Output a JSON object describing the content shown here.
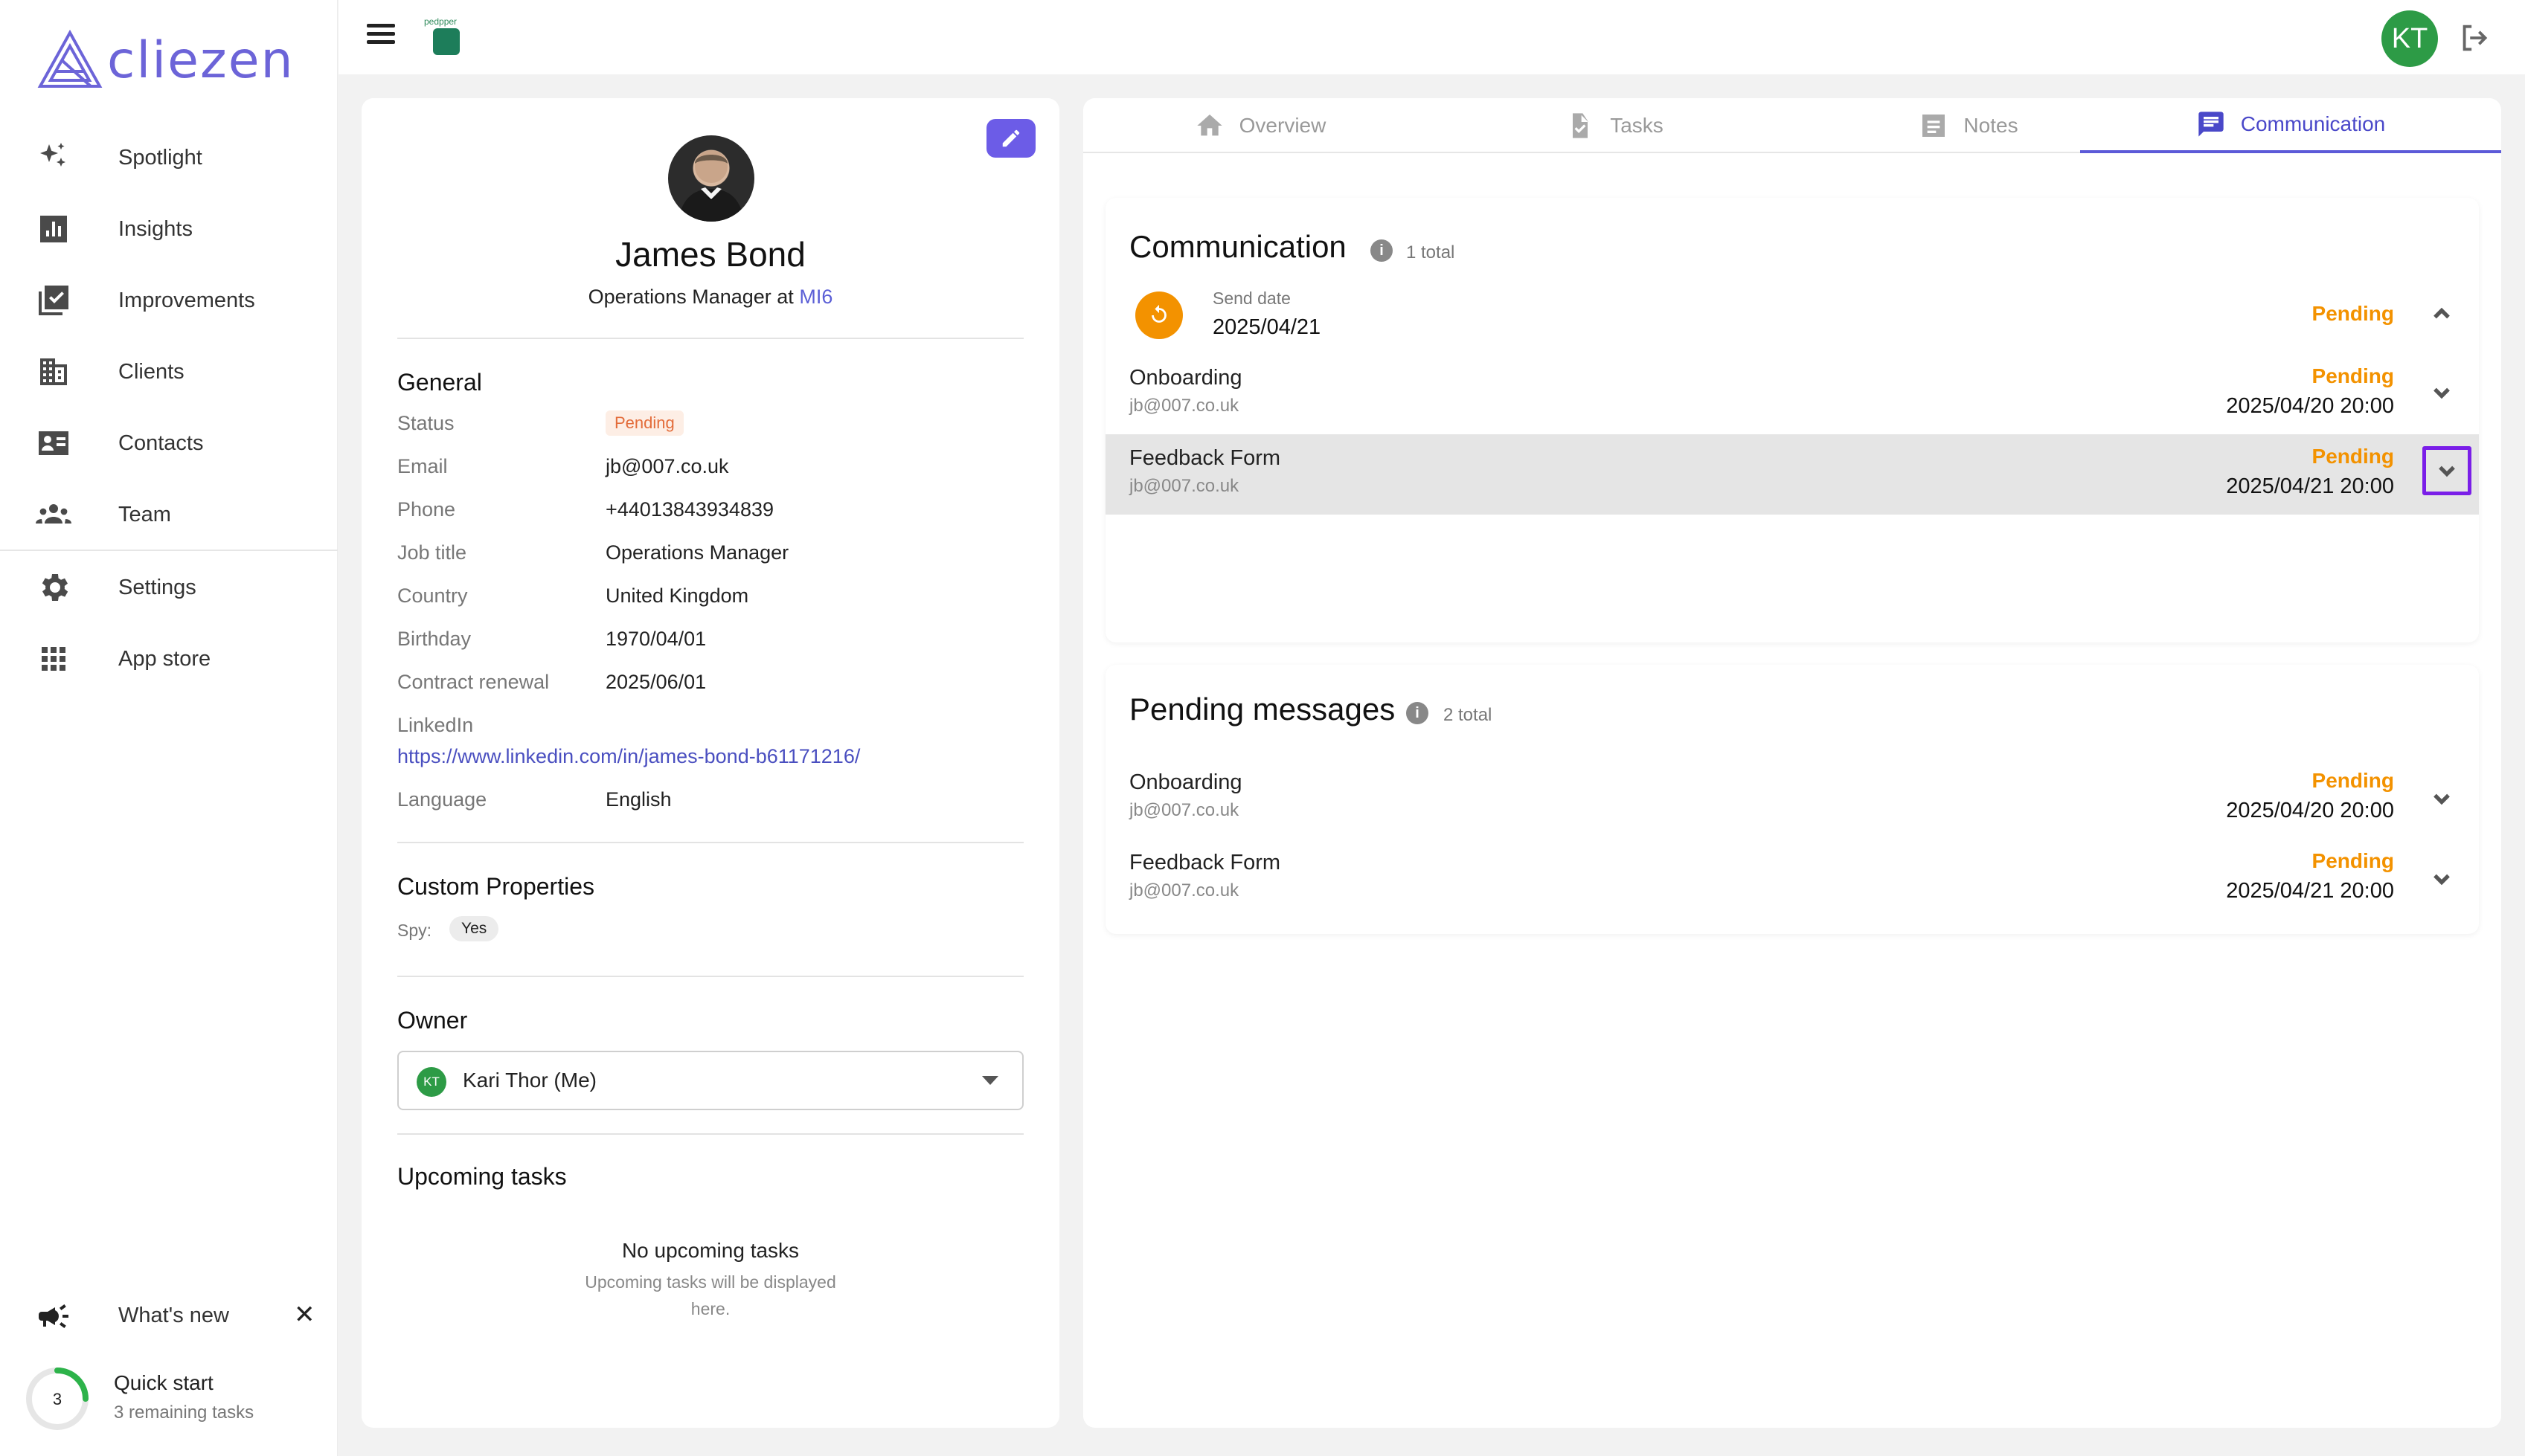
{
  "app": {
    "logo_text": "cliezen",
    "brand_small_text": "pedpper"
  },
  "sidebar": {
    "items": [
      {
        "label": "Spotlight",
        "icon": "sparkles-icon"
      },
      {
        "label": "Insights",
        "icon": "bar-chart-icon"
      },
      {
        "label": "Improvements",
        "icon": "checklist-icon"
      },
      {
        "label": "Clients",
        "icon": "building-icon"
      },
      {
        "label": "Contacts",
        "icon": "contact-card-icon"
      },
      {
        "label": "Team",
        "icon": "people-icon"
      },
      {
        "label": "Settings",
        "icon": "gear-icon"
      },
      {
        "label": "App store",
        "icon": "grid-icon"
      }
    ],
    "whats_new": "What's new",
    "quick_start": {
      "title": "Quick start",
      "subtitle": "3 remaining tasks",
      "count": "3",
      "progress": 0.25
    }
  },
  "topbar": {
    "user_initials": "KT"
  },
  "profile": {
    "name": "James Bond",
    "job_prefix": "Operations Manager at",
    "company": "MI6",
    "general_title": "General",
    "fields": {
      "status_label": "Status",
      "status_value": "Pending",
      "email_label": "Email",
      "email_value": "jb@007.co.uk",
      "phone_label": "Phone",
      "phone_value": "+44013843934839",
      "job_label": "Job title",
      "job_value": "Operations Manager",
      "country_label": "Country",
      "country_value": "United Kingdom",
      "birthday_label": "Birthday",
      "birthday_value": "1970/04/01",
      "renewal_label": "Contract renewal",
      "renewal_value": "2025/06/01",
      "linkedin_label": "LinkedIn",
      "linkedin_value": "https://www.linkedin.com/in/james-bond-b61171216/",
      "language_label": "Language",
      "language_value": "English"
    },
    "custom_title": "Custom Properties",
    "spy_label": "Spy:",
    "spy_value": "Yes",
    "owner_title": "Owner",
    "owner_initials": "KT",
    "owner_value": "Kari Thor (Me)",
    "upcoming_title": "Upcoming tasks",
    "upcoming_empty_title": "No upcoming tasks",
    "upcoming_empty_sub_1": "Upcoming tasks will be displayed",
    "upcoming_empty_sub_2": "here."
  },
  "tabs": [
    {
      "label": "Overview",
      "icon": "home-icon",
      "active": false
    },
    {
      "label": "Tasks",
      "icon": "task-file-icon",
      "active": false
    },
    {
      "label": "Notes",
      "icon": "notes-icon",
      "active": false
    },
    {
      "label": "Communication",
      "icon": "chat-icon",
      "active": true
    }
  ],
  "communication": {
    "title": "Communication",
    "total": "1 total",
    "send_date_label": "Send date",
    "send_date_value": "2025/04/21",
    "status": "Pending",
    "rows": [
      {
        "title": "Onboarding",
        "email": "jb@007.co.uk",
        "status": "Pending",
        "date": "2025/04/20 20:00"
      },
      {
        "title": "Feedback Form",
        "email": "jb@007.co.uk",
        "status": "Pending",
        "date": "2025/04/21 20:00"
      }
    ]
  },
  "pending_messages": {
    "title": "Pending messages",
    "total": "2 total",
    "rows": [
      {
        "title": "Onboarding",
        "email": "jb@007.co.uk",
        "status": "Pending",
        "date": "2025/04/20 20:00"
      },
      {
        "title": "Feedback Form",
        "email": "jb@007.co.uk",
        "status": "Pending",
        "date": "2025/04/21 20:00"
      }
    ]
  },
  "colors": {
    "accent": "#5c5ad8",
    "pending_orange": "#f39200",
    "avatar_green": "#2d9b46",
    "focus_outline": "#7a1ee8"
  }
}
